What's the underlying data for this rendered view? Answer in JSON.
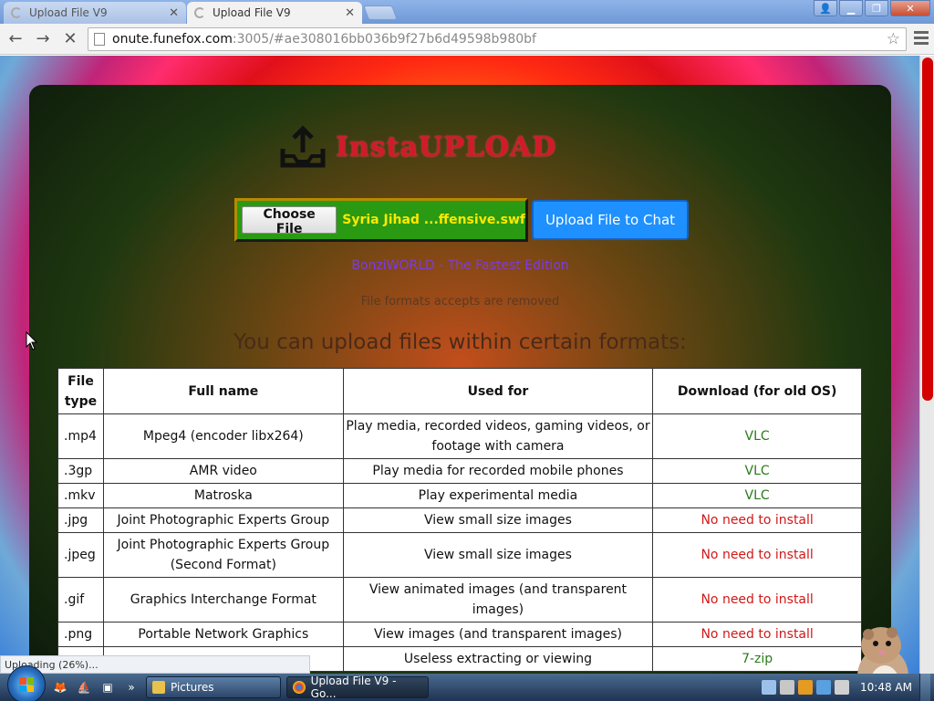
{
  "browser": {
    "tabs": [
      {
        "label": "Upload File V9",
        "active": false
      },
      {
        "label": "Upload File V9",
        "active": true
      }
    ],
    "url_host": "onute.funefox.com",
    "url_rest": ":3005/#ae308016bb036b9f27b6d49598b980bf",
    "status": "Uploading (26%)..."
  },
  "page": {
    "logo_text": "InstaUPLOAD",
    "choose_label": "Choose File",
    "file_name": "Syria Jihad ...ffensive.swf",
    "upload_button": "Upload File to Chat",
    "bonzi": "BonziWORLD - The Fastest Edition",
    "formats_note": "File formats accepts are removed",
    "heading": "You can upload files within certain formats:",
    "table": {
      "headers": [
        "File type",
        "Full name",
        "Used for",
        "Download (for old OS)"
      ],
      "rows": [
        {
          "type": ".mp4",
          "name": "Mpeg4 (encoder libx264)",
          "use": "Play media, recorded videos, gaming videos, or footage with camera",
          "download": "VLC",
          "status": "green"
        },
        {
          "type": ".3gp",
          "name": "AMR video",
          "use": "Play media for recorded mobile phones",
          "download": "VLC",
          "status": "green"
        },
        {
          "type": ".mkv",
          "name": "Matroska",
          "use": "Play experimental media",
          "download": "VLC",
          "status": "green"
        },
        {
          "type": ".jpg",
          "name": "Joint Photographic Experts Group",
          "use": "View small size images",
          "download": "No need to install",
          "status": "red"
        },
        {
          "type": ".jpeg",
          "name": "Joint Photographic Experts Group (Second Format)",
          "use": "View small size images",
          "download": "No need to install",
          "status": "red"
        },
        {
          "type": ".gif",
          "name": "Graphics Interchange Format",
          "use": "View animated images (and transparent images)",
          "download": "No need to install",
          "status": "red"
        },
        {
          "type": ".png",
          "name": "Portable Network Graphics",
          "use": "View images (and transparent images)",
          "download": "No need to install",
          "status": "red"
        },
        {
          "type": "",
          "name": "",
          "use": "Useless extracting or viewing",
          "download": "7-zip",
          "status": "green"
        }
      ]
    }
  },
  "taskbar": {
    "items": [
      {
        "label": "Pictures",
        "icon": "folder-icon",
        "active": false
      },
      {
        "label": "Upload File V9 - Go...",
        "icon": "chrome-icon",
        "active": true
      }
    ],
    "clock": "10:48 AM"
  },
  "colors": {
    "logo": "#d11a2a",
    "upload_button": "#1e90ff",
    "file_box": "#2a9a12",
    "filename": "#ffe800",
    "bonzi": "#7b3be8",
    "download_green": "#2a7a1a",
    "download_red": "#d11818"
  }
}
